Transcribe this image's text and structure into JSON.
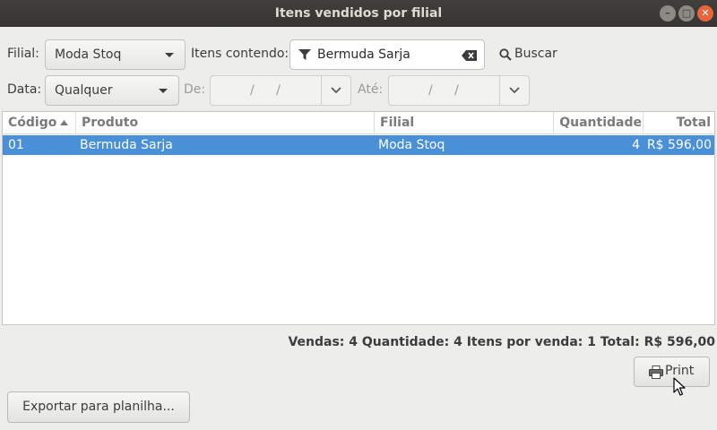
{
  "window": {
    "title": "Itens vendidos por filial"
  },
  "filters": {
    "branch_label": "Filial:",
    "branch_value": "Moda Stoq",
    "items_label": "Itens contendo:",
    "search_value": "Bermuda Sarja",
    "search_button": "Buscar",
    "date_label": "Data:",
    "date_value": "Qualquer",
    "from_label": "De:",
    "from_value": "/ /",
    "to_label": "Até:",
    "to_value": "/ /"
  },
  "table": {
    "columns": [
      "Código",
      "Produto",
      "Filial",
      "Quantidade",
      "Total"
    ],
    "sorted_column": "Código",
    "rows": [
      {
        "codigo": "01",
        "produto": "Bermuda Sarja",
        "filial": "Moda Stoq",
        "quantidade": "4",
        "total": "R$ 596,00",
        "selected": true
      }
    ]
  },
  "summary": {
    "text": "Vendas: 4 Quantidade: 4 Itens por venda: 1 Total: R$ 596,00"
  },
  "buttons": {
    "print": "Print",
    "export": "Exportar para planilha..."
  },
  "icons": [
    "minimize-icon",
    "maximize-icon",
    "close-icon",
    "filter-icon",
    "clear-text-icon",
    "search-icon",
    "chevron-down-icon",
    "printer-icon",
    "mouse-cursor-icon",
    "sort-ascending-icon"
  ],
  "colors": {
    "selection": "#4a90d9",
    "titlebar": "#3c3b37",
    "close_button": "#e8643a"
  }
}
